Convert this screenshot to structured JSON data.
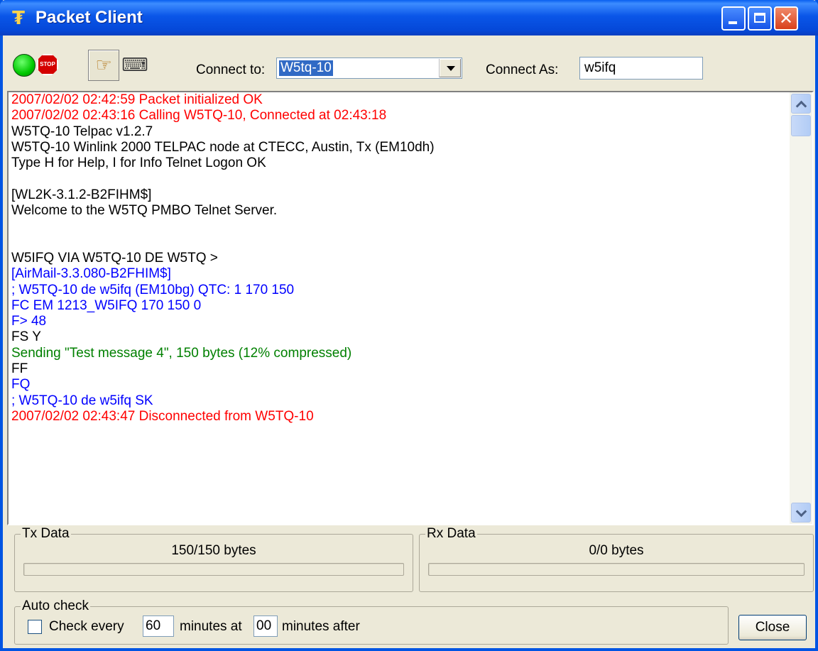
{
  "window": {
    "title": "Packet Client"
  },
  "toolbar": {
    "stop_text": "STOP",
    "connect_to_label": "Connect to:",
    "connect_to_value": "W5tq-10",
    "connect_as_label": "Connect As:",
    "connect_as_value": "w5ifq"
  },
  "log": [
    {
      "text": "2007/02/02 02:42:59 Packet initialized OK",
      "color": "#ff0000"
    },
    {
      "text": "2007/02/02 02:43:16 Calling W5TQ-10, Connected at 02:43:18",
      "color": "#ff0000"
    },
    {
      "text": "W5TQ-10 Telpac v1.2.7",
      "color": "#000000"
    },
    {
      "text": "W5TQ-10 Winlink 2000 TELPAC node at CTECC, Austin, Tx (EM10dh)",
      "color": "#000000"
    },
    {
      "text": "Type H for Help, I for Info Telnet Logon OK",
      "color": "#000000"
    },
    {
      "text": "",
      "color": "#000000"
    },
    {
      "text": "[WL2K-3.1.2-B2FIHM$]",
      "color": "#000000"
    },
    {
      "text": "Welcome to the W5TQ PMBO Telnet Server.",
      "color": "#000000"
    },
    {
      "text": "",
      "color": "#000000"
    },
    {
      "text": "",
      "color": "#000000"
    },
    {
      "text": "W5IFQ VIA W5TQ-10 DE W5TQ >",
      "color": "#000000"
    },
    {
      "text": "[AirMail-3.3.080-B2FHIM$]",
      "color": "#0000ff"
    },
    {
      "text": "; W5TQ-10 de w5ifq (EM10bg) QTC: 1 170 150",
      "color": "#0000ff"
    },
    {
      "text": "FC EM 1213_W5IFQ 170 150 0",
      "color": "#0000ff"
    },
    {
      "text": "F> 48",
      "color": "#0000ff"
    },
    {
      "text": "FS Y",
      "color": "#000000"
    },
    {
      "text": "Sending \"Test message 4\", 150 bytes (12% compressed)",
      "color": "#008000"
    },
    {
      "text": "FF",
      "color": "#000000"
    },
    {
      "text": "FQ",
      "color": "#0000ff"
    },
    {
      "text": "; W5TQ-10 de w5ifq SK",
      "color": "#0000ff"
    },
    {
      "text": "2007/02/02 02:43:47 Disconnected from W5TQ-10",
      "color": "#ff0000"
    }
  ],
  "tx": {
    "label": "Tx Data",
    "bytes": "150/150 bytes",
    "progress": 0
  },
  "rx": {
    "label": "Rx Data",
    "bytes": "0/0 bytes",
    "progress": 0
  },
  "auto_check": {
    "label": "Auto check",
    "checked": false,
    "check_every": "Check every",
    "every_value": "60",
    "minutes_at": "minutes at",
    "at_value": "00",
    "minutes_after": "minutes after"
  },
  "close_label": "Close"
}
